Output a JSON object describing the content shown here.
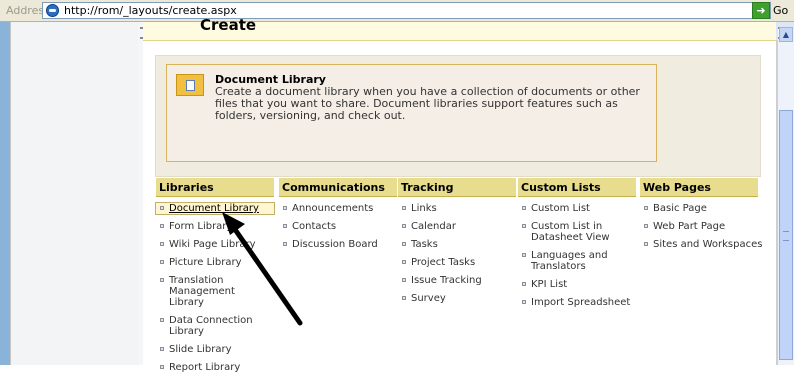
{
  "address_bar": {
    "label": "Address",
    "url": "http://rom/_layouts/create.aspx",
    "go_label": "Go"
  },
  "page": {
    "title_peek": "Create"
  },
  "selected_item": {
    "title": "Document Library",
    "description": "Create a document library when you have a collection of documents or other files that you want to share.  Document libraries support features such as folders, versioning, and check out."
  },
  "columns": [
    {
      "header": "Libraries",
      "items": [
        "Document Library",
        "Form Library",
        "Wiki Page Library",
        "Picture Library",
        "Translation Management Library",
        "Data Connection Library",
        "Slide Library",
        "Report Library"
      ]
    },
    {
      "header": "Communications",
      "items": [
        "Announcements",
        "Contacts",
        "Discussion Board"
      ]
    },
    {
      "header": "Tracking",
      "items": [
        "Links",
        "Calendar",
        "Tasks",
        "Project Tasks",
        "Issue Tracking",
        "Survey"
      ]
    },
    {
      "header": "Custom Lists",
      "items": [
        "Custom List",
        "Custom List in Datasheet View",
        "Languages and Translators",
        "KPI List",
        "Import Spreadsheet"
      ]
    },
    {
      "header": "Web Pages",
      "items": [
        "Basic Page",
        "Web Part Page",
        "Sites and Workspaces"
      ]
    }
  ],
  "icons": {
    "ie": "ie-page-icon",
    "go": "go-arrow-icon",
    "dropdown": "chevron-down-icon",
    "doc_library": "document-library-icon"
  },
  "colors": {
    "header_bg": "#e8dd8e",
    "left_pane": "#8ab3da",
    "panel_bg": "#f5eee6"
  }
}
